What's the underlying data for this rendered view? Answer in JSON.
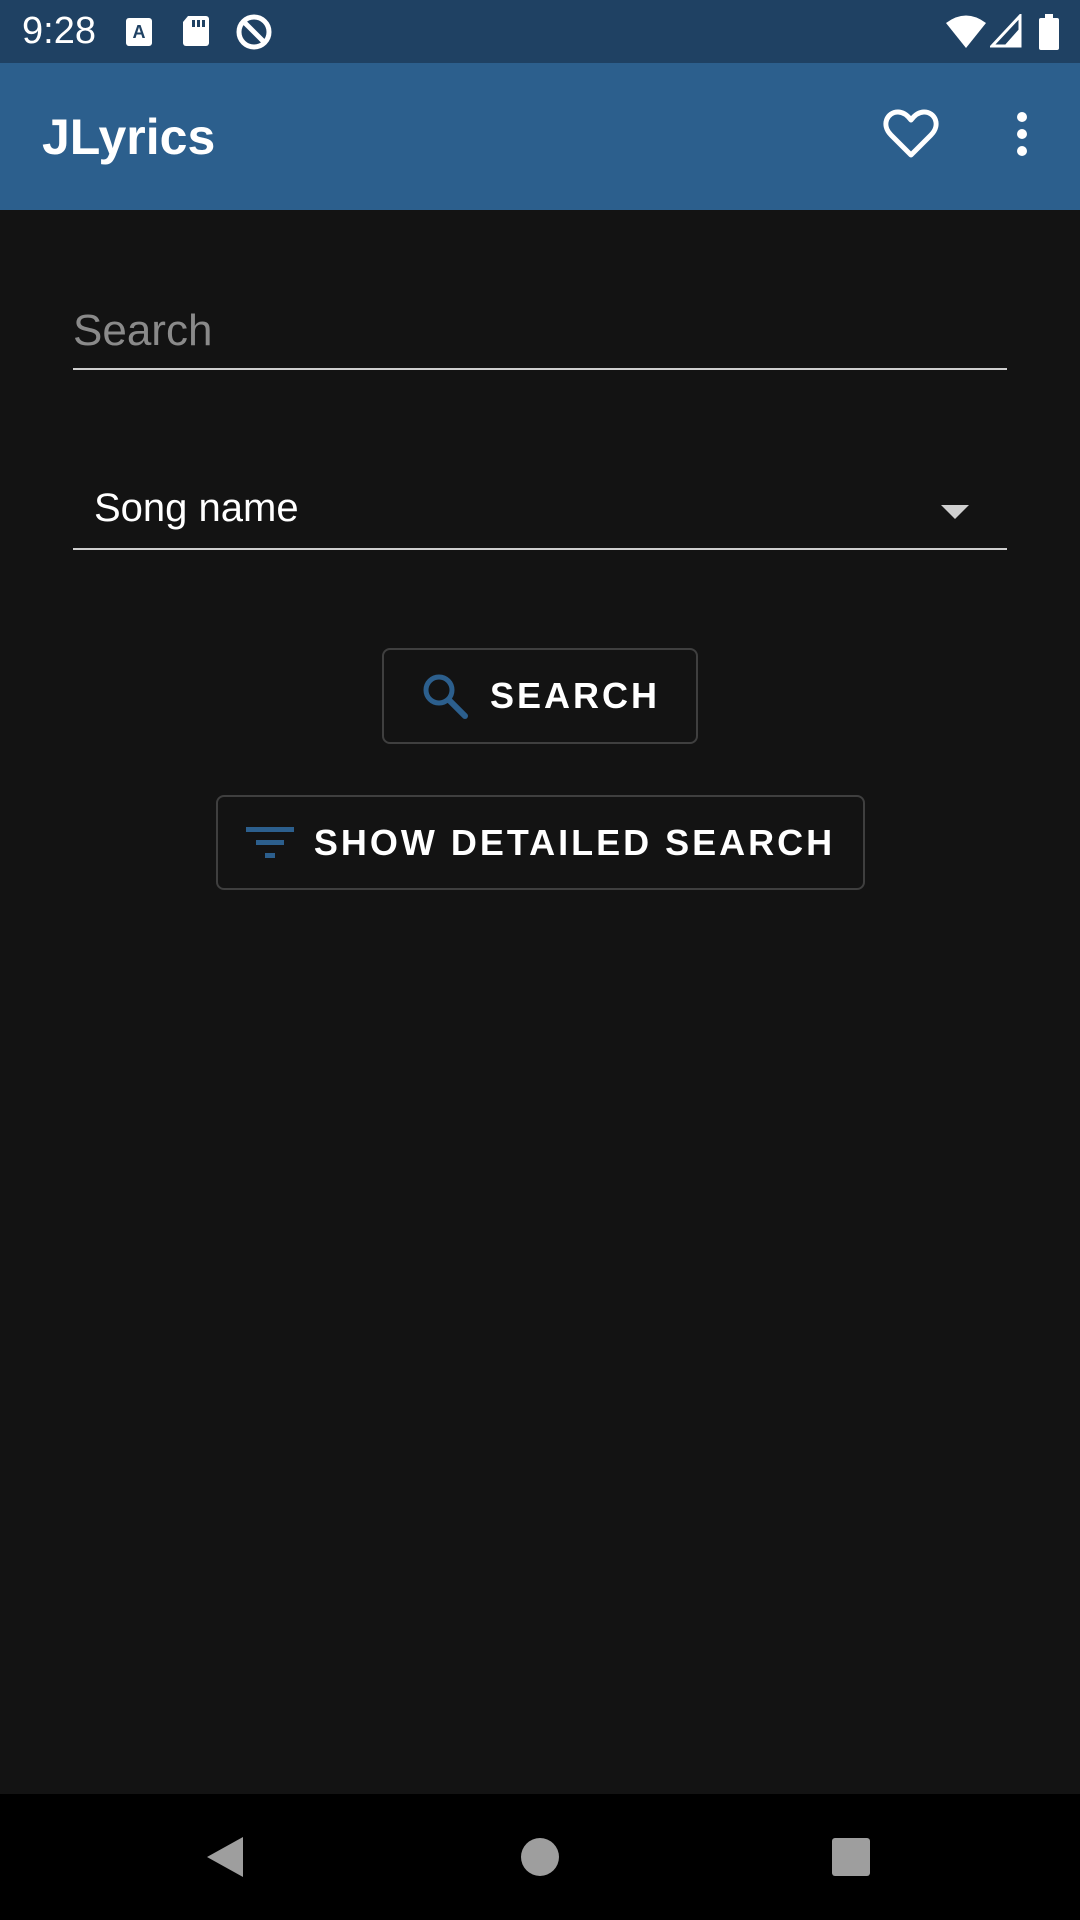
{
  "status_bar": {
    "time": "9:28",
    "icons_left": [
      "a-text-icon",
      "sd-card-icon",
      "sync-icon"
    ],
    "icons_right": [
      "wifi-icon",
      "signal-icon",
      "battery-icon"
    ]
  },
  "app_bar": {
    "title": "JLyrics",
    "actions": [
      "favorites-heart-icon",
      "more-vert-icon"
    ],
    "background": "#2c5f8d"
  },
  "search": {
    "placeholder": "Search",
    "value": ""
  },
  "search_type": {
    "selected": "Song name"
  },
  "buttons": {
    "search_label": "SEARCH",
    "detailed_label": "SHOW DETAILED SEARCH",
    "icon_color": "#2c5f8d"
  },
  "nav": {
    "items": [
      "back-icon",
      "home-icon",
      "recents-icon"
    ]
  }
}
